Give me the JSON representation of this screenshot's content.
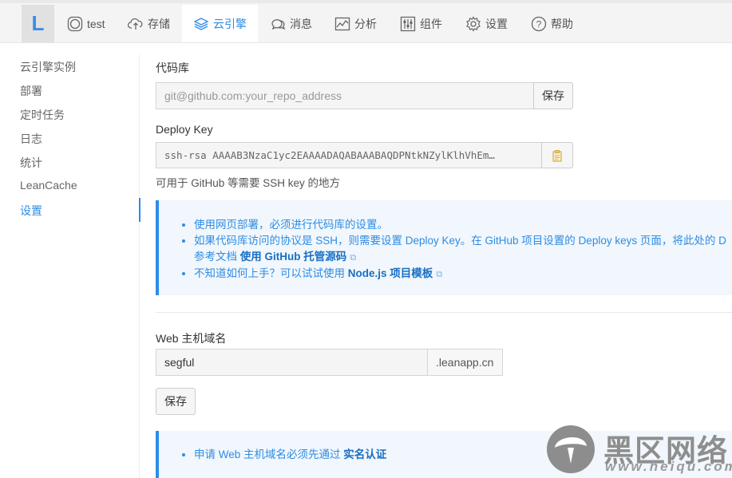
{
  "nav": {
    "logo": "L",
    "items": [
      {
        "label": "test",
        "icon": "app-circle-icon"
      },
      {
        "label": "存储",
        "icon": "cloud-upload-icon"
      },
      {
        "label": "云引擎",
        "icon": "layers-icon",
        "active": true
      },
      {
        "label": "消息",
        "icon": "chat-bubbles-icon"
      },
      {
        "label": "分析",
        "icon": "chart-line-icon"
      },
      {
        "label": "组件",
        "icon": "sliders-icon"
      },
      {
        "label": "设置",
        "icon": "gear-icon"
      },
      {
        "label": "帮助",
        "icon": "question-circle-icon"
      }
    ]
  },
  "sidebar": {
    "items": [
      {
        "label": "云引擎实例"
      },
      {
        "label": "部署"
      },
      {
        "label": "定时任务"
      },
      {
        "label": "日志"
      },
      {
        "label": "统计"
      },
      {
        "label": "LeanCache"
      },
      {
        "label": "设置",
        "active": true
      }
    ]
  },
  "repo": {
    "label": "代码库",
    "placeholder": "git@github.com:your_repo_address",
    "save_label": "保存"
  },
  "deploy_key": {
    "label": "Deploy Key",
    "value": "ssh-rsa AAAAB3NzaC1yc2EAAAADAQABAAABAQDPNtkNZylKlhVhEm…",
    "help": "可用于 GitHub 等需要 SSH key 的地方"
  },
  "info1": {
    "item1": "使用网页部署，必须进行代码库的设置。",
    "item2_text": "如果代码库访问的协议是 SSH，则需要设置 Deploy Key。在 GitHub 项目设置的 Deploy keys 页面，将此处的 D",
    "item2_cont": "参考文档",
    "item2_link": "使用 GitHub 托管源码",
    "item3_text": "不知道如何上手？可以试试使用",
    "item3_link": "Node.js 项目模板"
  },
  "domain": {
    "label": "Web 主机域名",
    "value": "segful",
    "suffix": ".leanapp.cn",
    "save_label": "保存"
  },
  "info2": {
    "text": "申请 Web 主机域名必须先通过",
    "link": "实名认证"
  },
  "watermark": {
    "text": "黑区网络",
    "url": "www.heiqu.com"
  },
  "colors": {
    "accent": "#2e8ce5",
    "info_bg": "#f1f7fc"
  }
}
